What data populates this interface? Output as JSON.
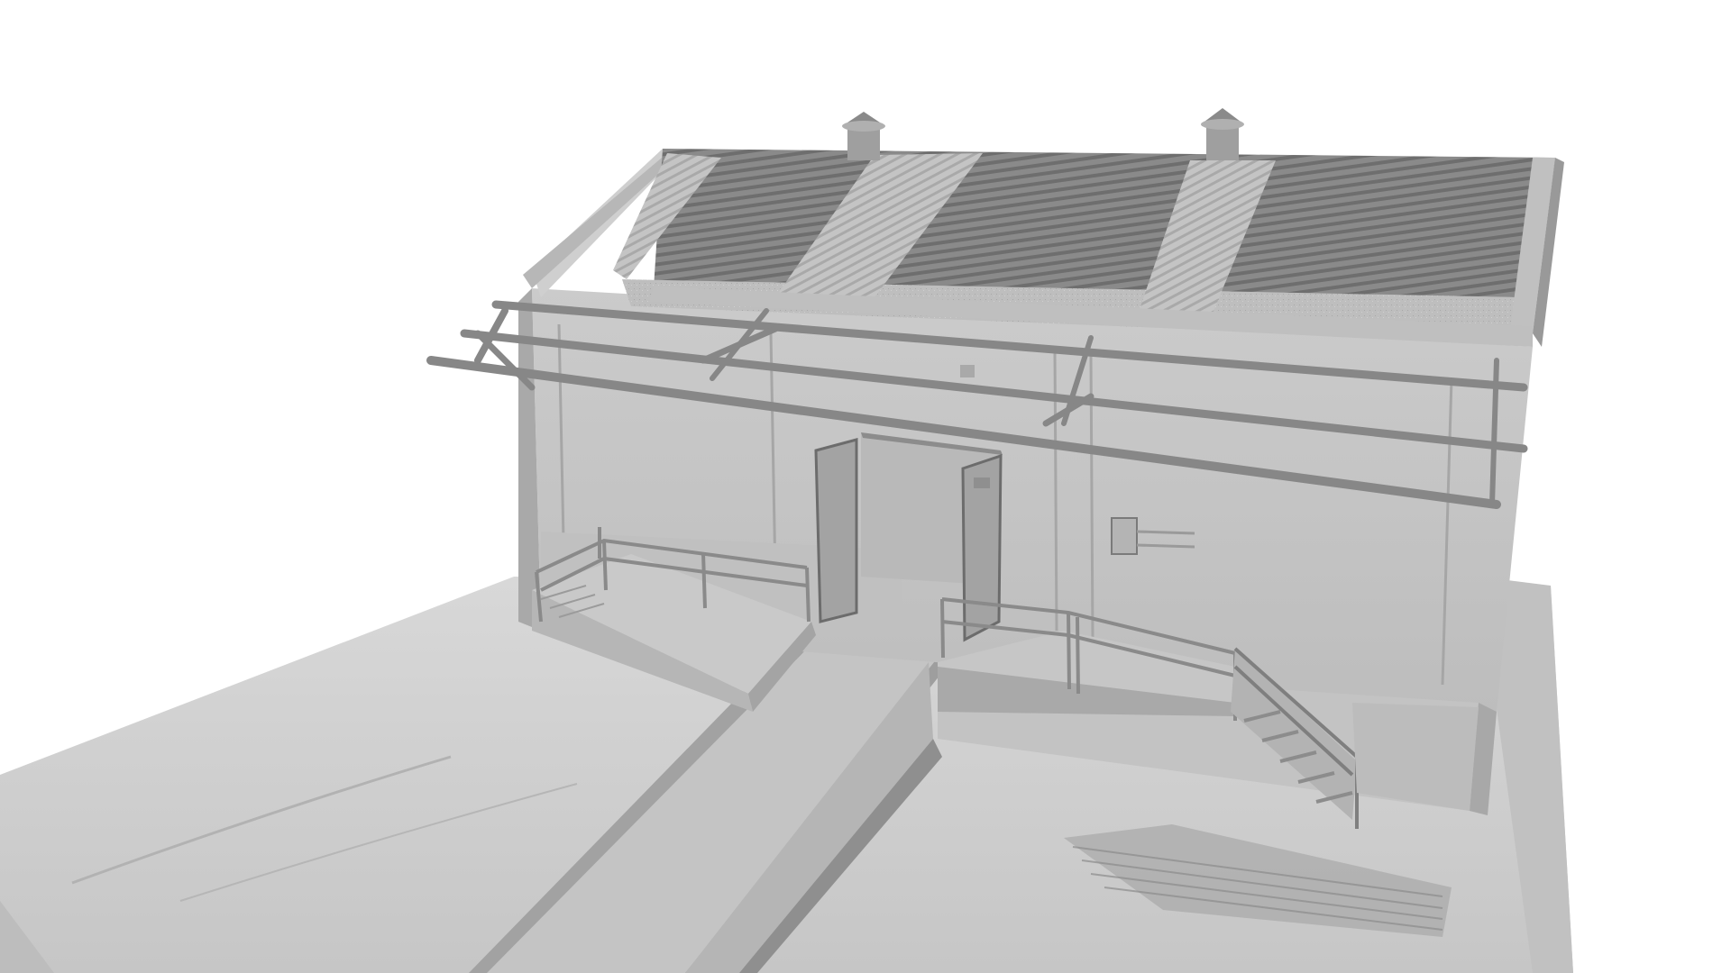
{
  "scene": {
    "background": "#ffffff",
    "palette": {
      "ground": "#cfcfcf",
      "ground_dark": "#b9b9b9",
      "wall": "#c8c8c8",
      "wall_shadow": "#b0b0b0",
      "roof_light": "#bdbdbd",
      "roof_dark": "#7d7d7d",
      "steel": "#8e8e8e",
      "rail": "#9a9a9a",
      "edge": "#5a5a5a"
    }
  }
}
